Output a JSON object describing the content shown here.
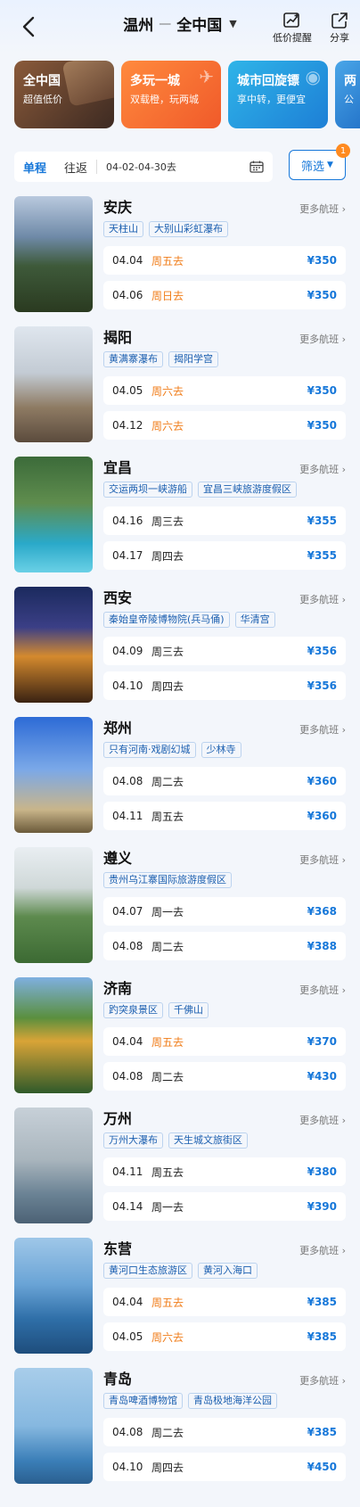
{
  "header": {
    "from_city": "温州",
    "to_city": "全中国",
    "price_alert_label": "低价提醒",
    "share_label": "分享"
  },
  "promos": [
    {
      "title": "全中国",
      "subtitle": "超值低价"
    },
    {
      "title": "多玩一城",
      "subtitle": "双载橙，玩两城"
    },
    {
      "title": "城市回旋镖",
      "subtitle": "享中转，更便宜"
    },
    {
      "title": "两",
      "subtitle": "公"
    }
  ],
  "filter": {
    "tab_oneway": "单程",
    "tab_roundtrip": "往返",
    "date_range": "04-02-04-30去",
    "filter_label": "筛选",
    "filter_count": "1"
  },
  "destinations": [
    {
      "name": "安庆",
      "tags": [
        "天柱山",
        "大别山彩虹瀑布"
      ],
      "flights": [
        {
          "date": "04.04",
          "day": "周五去",
          "hot": true,
          "price": "¥350"
        },
        {
          "date": "04.06",
          "day": "周日去",
          "hot": true,
          "price": "¥350"
        }
      ]
    },
    {
      "name": "揭阳",
      "tags": [
        "黄满寨瀑布",
        "揭阳学宫"
      ],
      "flights": [
        {
          "date": "04.05",
          "day": "周六去",
          "hot": true,
          "price": "¥350"
        },
        {
          "date": "04.12",
          "day": "周六去",
          "hot": true,
          "price": "¥350"
        }
      ]
    },
    {
      "name": "宜昌",
      "tags": [
        "交运两坝一峡游船",
        "宜昌三峡旅游度假区"
      ],
      "flights": [
        {
          "date": "04.16",
          "day": "周三去",
          "hot": false,
          "price": "¥355"
        },
        {
          "date": "04.17",
          "day": "周四去",
          "hot": false,
          "price": "¥355"
        }
      ]
    },
    {
      "name": "西安",
      "tags": [
        "秦始皇帝陵博物院(兵马俑)",
        "华清宫"
      ],
      "flights": [
        {
          "date": "04.09",
          "day": "周三去",
          "hot": false,
          "price": "¥356"
        },
        {
          "date": "04.10",
          "day": "周四去",
          "hot": false,
          "price": "¥356"
        }
      ]
    },
    {
      "name": "郑州",
      "tags": [
        "只有河南·戏剧幻城",
        "少林寺"
      ],
      "flights": [
        {
          "date": "04.08",
          "day": "周二去",
          "hot": false,
          "price": "¥360"
        },
        {
          "date": "04.11",
          "day": "周五去",
          "hot": false,
          "price": "¥360"
        }
      ]
    },
    {
      "name": "遵义",
      "tags": [
        "贵州乌江寨国际旅游度假区"
      ],
      "flights": [
        {
          "date": "04.07",
          "day": "周一去",
          "hot": false,
          "price": "¥368"
        },
        {
          "date": "04.08",
          "day": "周二去",
          "hot": false,
          "price": "¥388"
        }
      ]
    },
    {
      "name": "济南",
      "tags": [
        "趵突泉景区",
        "千佛山"
      ],
      "flights": [
        {
          "date": "04.04",
          "day": "周五去",
          "hot": true,
          "price": "¥370"
        },
        {
          "date": "04.08",
          "day": "周二去",
          "hot": false,
          "price": "¥430"
        }
      ]
    },
    {
      "name": "万州",
      "tags": [
        "万州大瀑布",
        "天生城文旅街区"
      ],
      "flights": [
        {
          "date": "04.11",
          "day": "周五去",
          "hot": false,
          "price": "¥380"
        },
        {
          "date": "04.14",
          "day": "周一去",
          "hot": false,
          "price": "¥390"
        }
      ]
    },
    {
      "name": "东营",
      "tags": [
        "黄河口生态旅游区",
        "黄河入海口"
      ],
      "flights": [
        {
          "date": "04.04",
          "day": "周五去",
          "hot": true,
          "price": "¥385"
        },
        {
          "date": "04.05",
          "day": "周六去",
          "hot": true,
          "price": "¥385"
        }
      ]
    },
    {
      "name": "青岛",
      "tags": [
        "青岛啤酒博物馆",
        "青岛极地海洋公园"
      ],
      "flights": [
        {
          "date": "04.08",
          "day": "周二去",
          "hot": false,
          "price": "¥385"
        },
        {
          "date": "04.10",
          "day": "周四去",
          "hot": false,
          "price": "¥450"
        }
      ]
    }
  ],
  "more_flights_label": "更多航班",
  "colors": {
    "accent": "#1677d9",
    "hot_day": "#f07d1a",
    "badge": "#ff8a1f"
  }
}
